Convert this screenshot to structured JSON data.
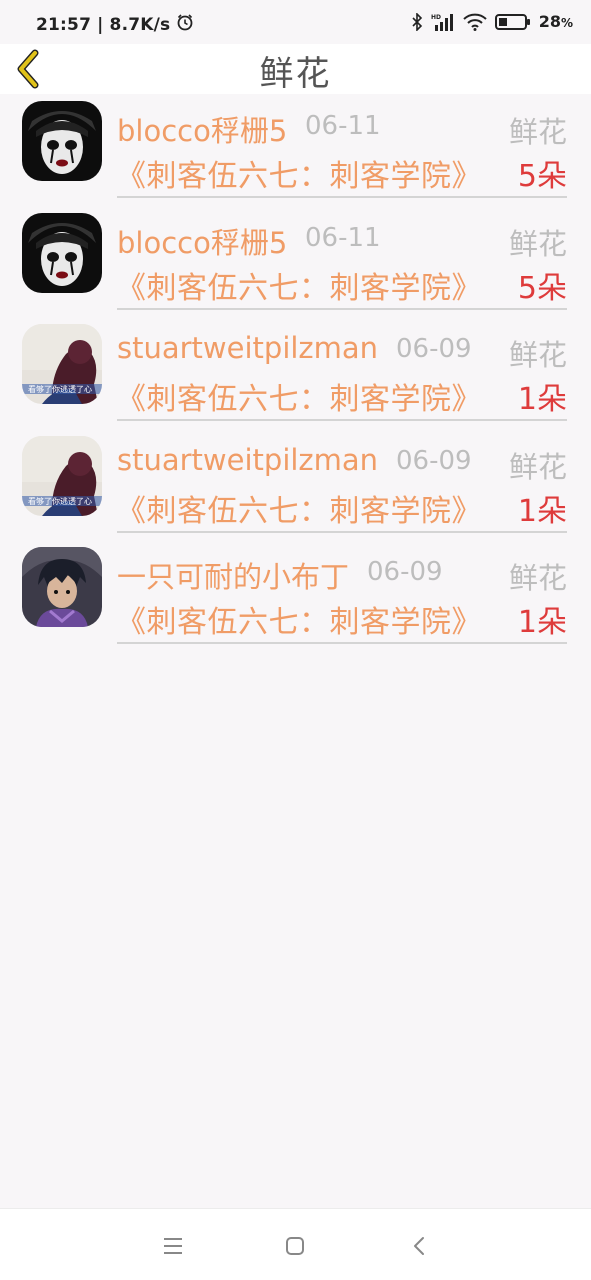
{
  "status_bar": {
    "time": "21:57",
    "network_speed": "8.7K/s",
    "battery": "28",
    "battery_unit": "%",
    "battery_level": 0.28,
    "icons": [
      "alarm-icon",
      "bluetooth-icon",
      "signal-icon",
      "wifi-icon",
      "battery-icon"
    ]
  },
  "header": {
    "title": "鲜花",
    "back_icon": "chevron-left-icon",
    "accent_color": "#e0c21a"
  },
  "colors": {
    "username": "#f09c66",
    "date": "#bdbdbd",
    "count": "#de3b3b",
    "background": "#f8f6f8"
  },
  "records": [
    {
      "username": "blocco稃栅5",
      "date": "06-11",
      "type": "鲜花",
      "book": "《刺客伍六七：刺客学院》",
      "count": "5朵",
      "avatar": "mime-portrait"
    },
    {
      "username": "blocco稃栅5",
      "date": "06-11",
      "type": "鲜花",
      "book": "《刺客伍六七：刺客学院》",
      "count": "5朵",
      "avatar": "mime-portrait"
    },
    {
      "username": "stuartweitpilzman",
      "date": "06-09",
      "type": "鲜花",
      "book": "《刺客伍六七：刺客学院》",
      "count": "1朵",
      "avatar": "girl-silhouette",
      "avatar_caption": "看够了你逃透了心"
    },
    {
      "username": "stuartweitpilzman",
      "date": "06-09",
      "type": "鲜花",
      "book": "《刺客伍六七：刺客学院》",
      "count": "1朵",
      "avatar": "girl-silhouette",
      "avatar_caption": "看够了你逃透了心"
    },
    {
      "username": "一只可耐的小布丁",
      "date": "06-09",
      "type": "鲜花",
      "book": "《刺客伍六七：刺客学院》",
      "count": "1朵",
      "avatar": "anime-character"
    }
  ],
  "bottom_nav": {
    "buttons": [
      "menu-icon",
      "home-icon",
      "back-icon"
    ]
  }
}
